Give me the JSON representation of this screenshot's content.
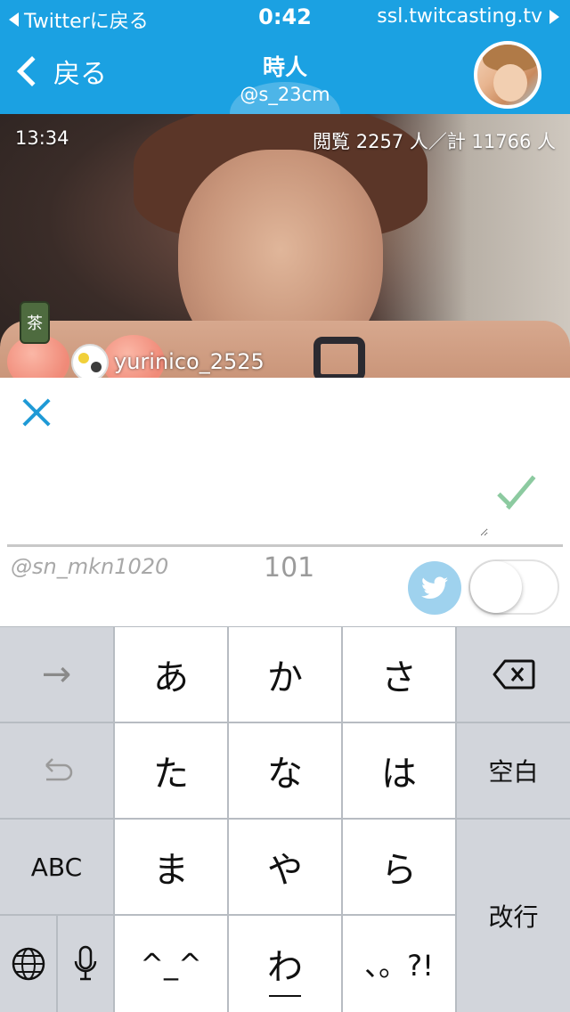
{
  "status_bar": {
    "back_app": "Twitterに戻る",
    "clock": "0:42",
    "url": "ssl.twitcasting.tv"
  },
  "nav": {
    "back_label": "戻る",
    "title": "時人",
    "handle": "@s_23cm"
  },
  "video": {
    "elapsed": "13:34",
    "viewers": "閲覧 2257 人／計 11766 人",
    "tea_item": "茶",
    "gift_user": "yurinico_2525"
  },
  "comment": {
    "input_value": "",
    "user_handle": "@sn_mkn1020",
    "char_count": "101",
    "twitter_toggle_on": false
  },
  "colors": {
    "accent": "#1ba1e2",
    "send_check": "#8ccaa0",
    "close_x": "#1f9ad6",
    "twitter": "#9fd2ee"
  },
  "keyboard": {
    "row1": [
      "→",
      "あ",
      "か",
      "さ",
      "⌫"
    ],
    "row2": [
      "↺",
      "た",
      "な",
      "は",
      "空白"
    ],
    "row3": [
      "ABC",
      "ま",
      "や",
      "ら",
      "改行"
    ],
    "row4": [
      "🌐",
      "🎤",
      "^_^",
      "わ",
      "、。?!"
    ]
  }
}
